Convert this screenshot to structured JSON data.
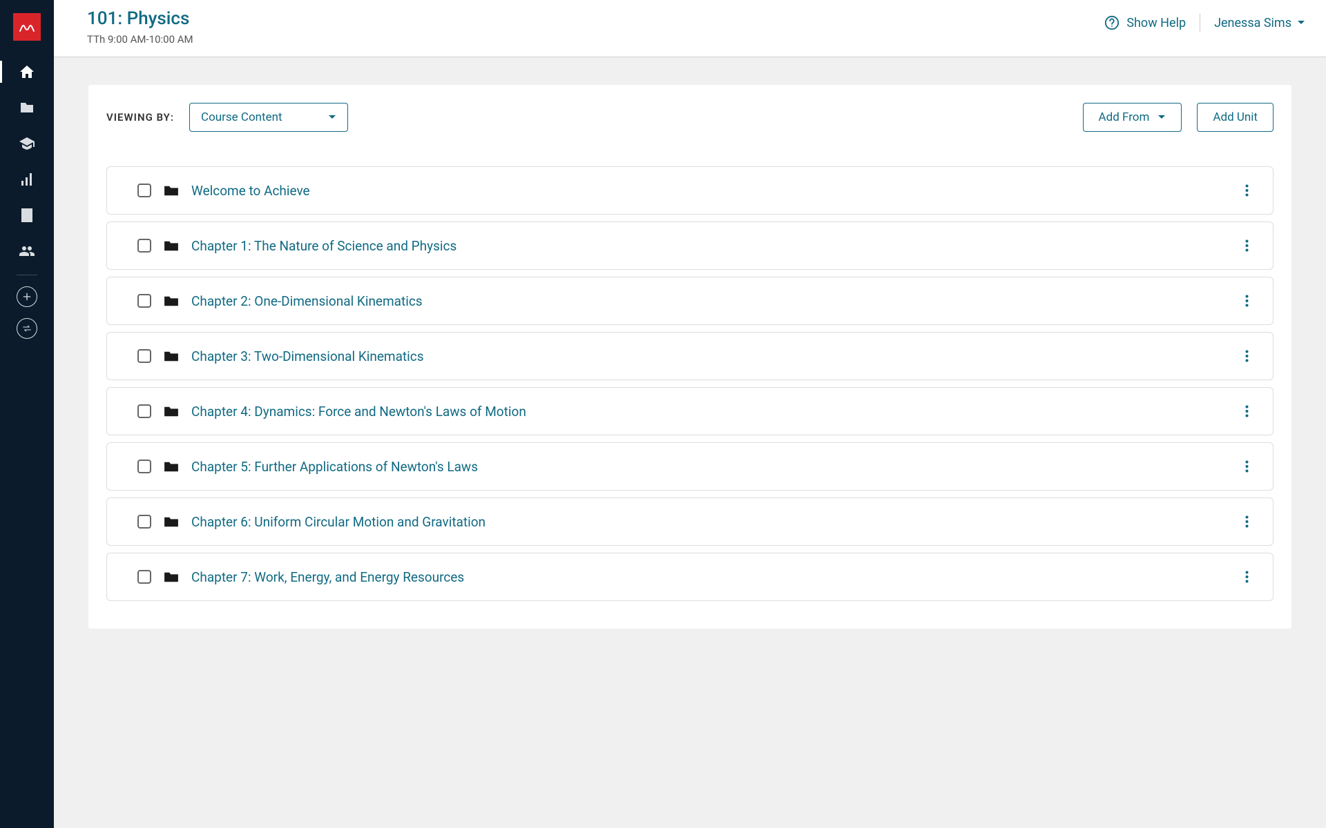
{
  "header": {
    "course_title": "101: Physics",
    "course_subtitle": "TTh 9:00 AM-10:00 AM",
    "show_help": "Show Help",
    "user_name": "Jenessa Sims"
  },
  "toolbar": {
    "viewing_by_label": "VIEWING BY:",
    "viewing_by_value": "Course Content",
    "add_from_label": "Add From",
    "add_unit_label": "Add Unit"
  },
  "units": [
    {
      "title": "Welcome to Achieve"
    },
    {
      "title": "Chapter 1: The Nature of Science and Physics"
    },
    {
      "title": "Chapter 2: One-Dimensional Kinematics"
    },
    {
      "title": "Chapter 3: Two-Dimensional Kinematics"
    },
    {
      "title": "Chapter 4: Dynamics: Force and Newton's Laws of Motion"
    },
    {
      "title": "Chapter 5: Further Applications of Newton's Laws"
    },
    {
      "title": "Chapter 6: Uniform Circular Motion and Gravitation"
    },
    {
      "title": "Chapter 7: Work, Energy, and Energy Resources"
    }
  ]
}
